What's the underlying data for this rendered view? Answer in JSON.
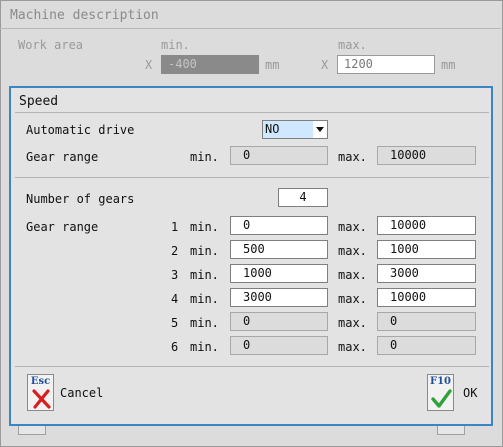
{
  "background_window": {
    "title": "Machine description",
    "work_area_label": "Work area",
    "min_header": "min.",
    "max_header": "max.",
    "x_label": "X",
    "x_min_value": "-400",
    "x_max_value": "1200",
    "unit": "mm"
  },
  "dialog": {
    "title": "Speed",
    "automatic_drive_label": "Automatic drive",
    "automatic_drive_value": "NO",
    "gear_range_label": "Gear range",
    "min_label": "min.",
    "max_label": "max.",
    "gear_range_min": "0",
    "gear_range_max": "10000",
    "number_of_gears_label": "Number of gears",
    "number_of_gears_value": "4",
    "gears_label": "Gear range",
    "gears": [
      {
        "num": "1",
        "min": "0",
        "max": "10000"
      },
      {
        "num": "2",
        "min": "500",
        "max": "1000"
      },
      {
        "num": "3",
        "min": "1000",
        "max": "3000"
      },
      {
        "num": "4",
        "min": "3000",
        "max": "10000"
      },
      {
        "num": "5",
        "min": "0",
        "max": "0"
      },
      {
        "num": "6",
        "min": "0",
        "max": "0"
      }
    ],
    "cancel_key": "Esc",
    "cancel_label": "Cancel",
    "ok_key": "F10",
    "ok_label": "OK"
  },
  "colors": {
    "dialog_border": "#3a86c4",
    "cancel_icon": "#d62020",
    "ok_icon": "#2fa33a"
  },
  "icons": {
    "cancel": "red-x-icon",
    "ok": "green-check-icon"
  }
}
